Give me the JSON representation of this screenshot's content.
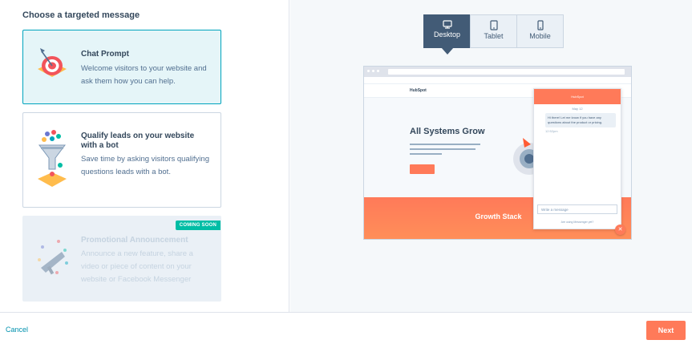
{
  "heading": "Choose a targeted message",
  "cards": [
    {
      "title": "Chat Prompt",
      "description": "Welcome visitors to your website and ask them how you can help.",
      "icon": "target-icon"
    },
    {
      "title": "Qualify leads on your website with a bot",
      "description": "Save time by asking visitors qualifying questions leads with a bot.",
      "icon": "funnel-icon"
    },
    {
      "title": "Promotional Announcement",
      "description": "Announce a new feature, share a video or piece of content on your website or Facebook Messenger",
      "badge": "COMING SOON",
      "icon": "megaphone-icon"
    }
  ],
  "device_tabs": [
    {
      "label": "Desktop",
      "icon": "monitor-icon",
      "active": true
    },
    {
      "label": "Tablet",
      "icon": "tablet-icon",
      "active": false
    },
    {
      "label": "Mobile",
      "icon": "mobile-icon",
      "active": false
    }
  ],
  "preview": {
    "logo": "HubSpot",
    "hero_title": "All Systems Grow",
    "growth_stack": "Growth Stack",
    "chat_header": "HubSpot",
    "chat_date": "May 12",
    "chat_message": "Hi there! Let me know if you have any questions about the product or pricing.",
    "chat_time": "12:52pm",
    "chat_input_placeholder": "Write a message",
    "chat_powered": "Are using Messenger yet?"
  },
  "footer": {
    "cancel": "Cancel",
    "next": "Next"
  },
  "colors": {
    "accent": "#ff7a59",
    "teal": "#00a4bd",
    "dark": "#425b76",
    "badge": "#00bda5"
  }
}
